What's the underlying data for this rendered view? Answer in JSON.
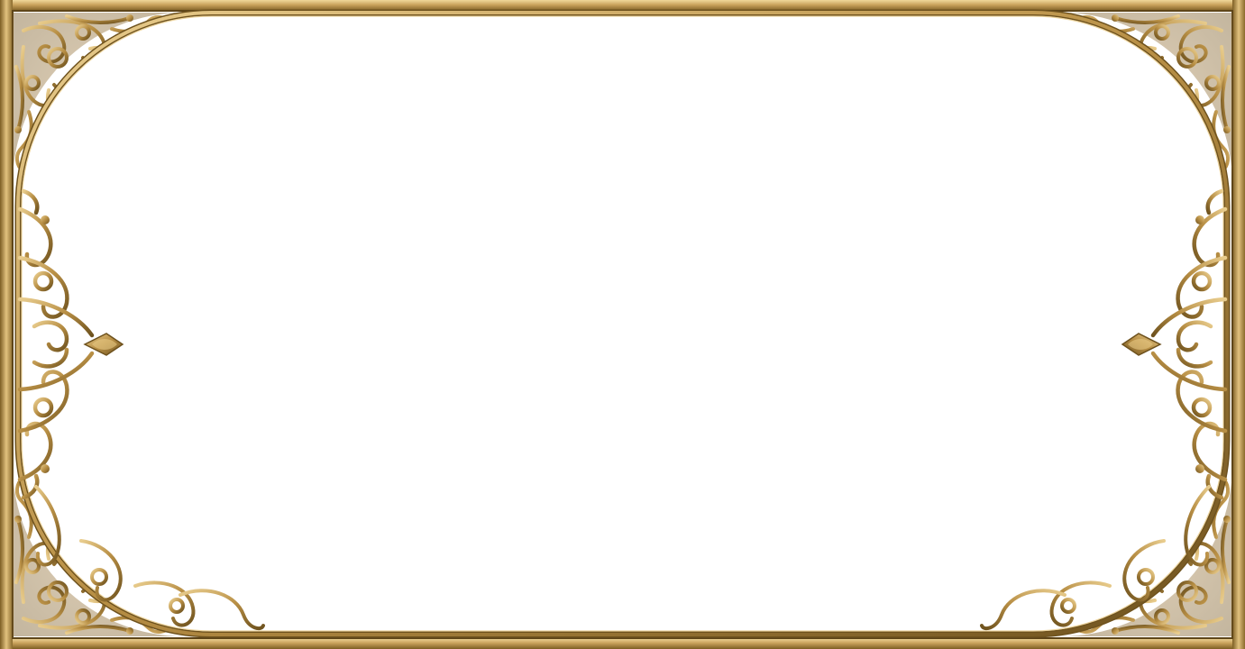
{
  "frame": {
    "style": "ornate-gold-filigree-border",
    "colors": {
      "gold_light": "#e7c986",
      "gold_mid": "#c9a25c",
      "gold_dark": "#8a6a2c",
      "gold_shadow": "#5e4518",
      "panel": "#ffffff"
    },
    "ornaments": [
      "top-left-corner-filigree",
      "top-right-corner-filigree",
      "left-middle-finial",
      "right-middle-finial",
      "bottom-left-corner-filigree",
      "bottom-right-corner-filigree"
    ]
  }
}
